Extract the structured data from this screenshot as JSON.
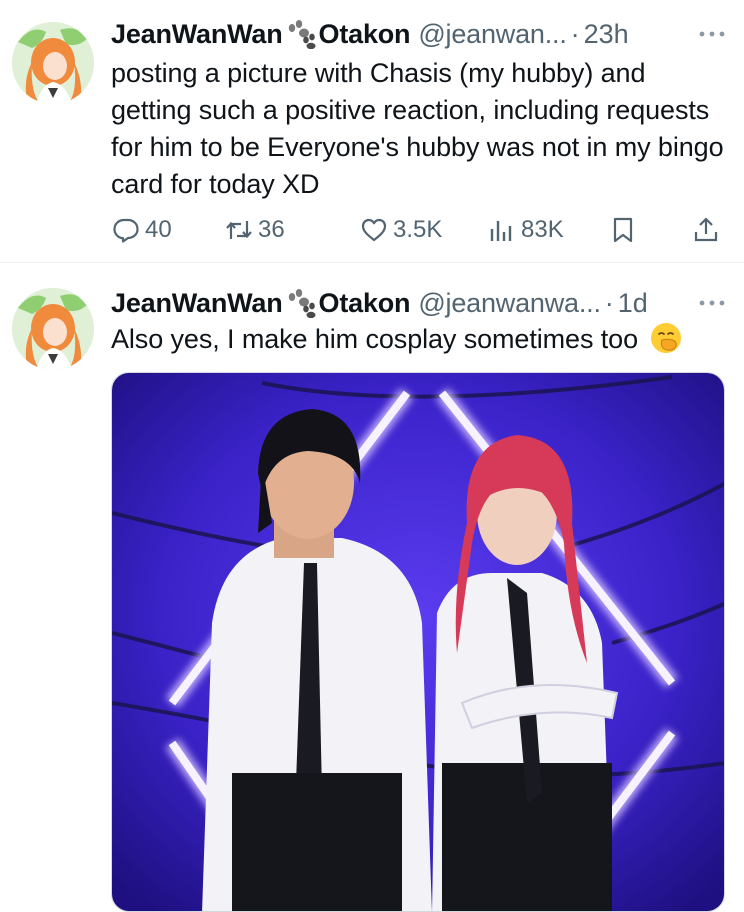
{
  "tweets": [
    {
      "display_name": "JeanWanWan",
      "display_name_suffix": "Otakon",
      "handle": "@jeanwan...",
      "separator": "·",
      "time": "23h",
      "text": "posting a picture with Chasis (my hubby) and getting such a positive reaction, including requests for him to be Everyone's hubby was not in my bingo card for today XD",
      "stats": {
        "replies": "40",
        "retweets": "36",
        "likes": "3.5K",
        "views": "83K"
      }
    },
    {
      "display_name": "JeanWanWan",
      "display_name_suffix": "Otakon",
      "handle": "@jeanwanwa...",
      "separator": "·",
      "time": "1d",
      "text": "Also yes, I make him cosplay sometimes too",
      "emoji": "face-with-hand-over-mouth",
      "media": "photo"
    }
  ],
  "colors": {
    "text_primary": "#0f1419",
    "text_secondary": "#536471",
    "divider": "#eff3f4",
    "photo_background": "#3a22c8",
    "neon": "#f2eaff"
  },
  "icons": [
    "more-icon",
    "paw-emoji",
    "reply-icon",
    "retweet-icon",
    "like-icon",
    "views-icon",
    "bookmark-icon",
    "share-icon",
    "hand-over-mouth-emoji"
  ]
}
